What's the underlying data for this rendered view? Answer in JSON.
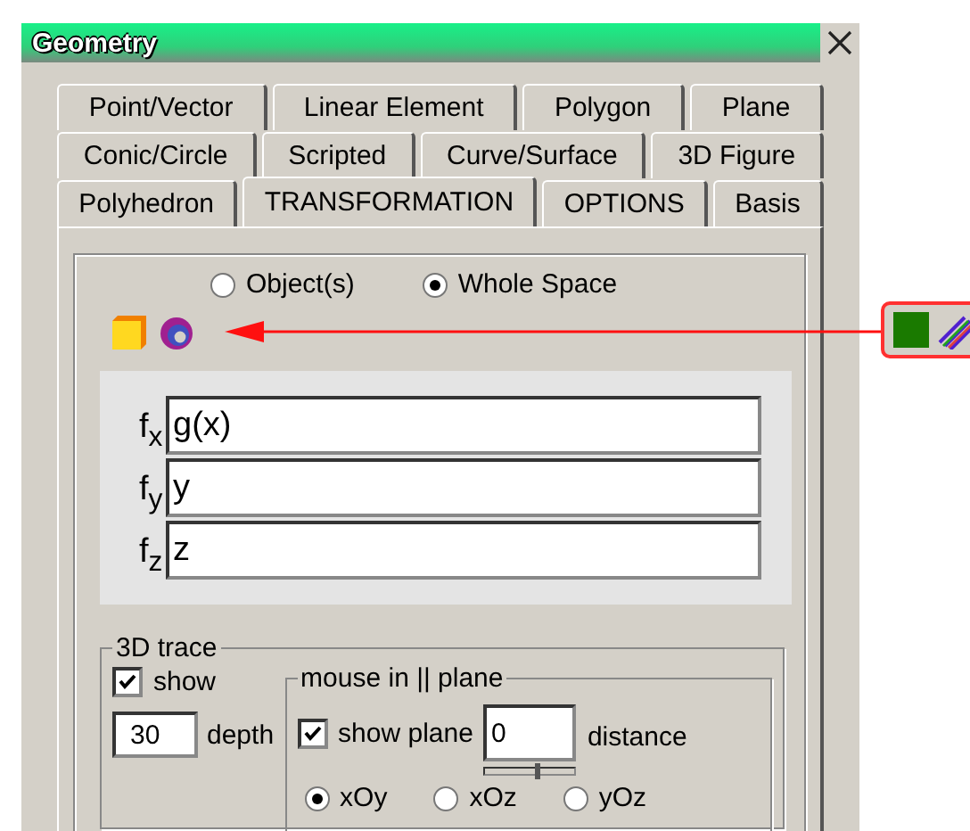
{
  "window": {
    "title": "Geometry"
  },
  "tab_rows": [
    [
      {
        "label": "Point/Vector",
        "selected": false
      },
      {
        "label": "Linear Element",
        "selected": false
      },
      {
        "label": "Polygon",
        "selected": false
      },
      {
        "label": "Plane",
        "selected": false
      }
    ],
    [
      {
        "label": "Conic/Circle",
        "selected": false
      },
      {
        "label": "Scripted",
        "selected": false
      },
      {
        "label": "Curve/Surface",
        "selected": false
      },
      {
        "label": "3D Figure",
        "selected": false
      }
    ],
    [
      {
        "label": "Polyhedron",
        "selected": false
      },
      {
        "label": "TRANSFORMATION",
        "selected": true
      },
      {
        "label": "OPTIONS",
        "selected": false
      },
      {
        "label": "Basis",
        "selected": false
      }
    ]
  ],
  "scope": [
    {
      "label": "Object(s)",
      "selected": false
    },
    {
      "label": "Whole Space",
      "selected": true
    }
  ],
  "functions": [
    {
      "label": "f$_{x}$",
      "value": "g(x)"
    },
    {
      "label": "f$_{y}$",
      "value": "y"
    },
    {
      "label": "f$_{z}$",
      "value": "z"
    }
  ],
  "trace": {
    "title": "3D trace",
    "show": {
      "label": "show",
      "checked": true
    },
    "depth": {
      "value": "30",
      "label": "depth"
    },
    "plane_group": {
      "title": "mouse in || plane",
      "show_plane": {
        "label": "show plane",
        "checked": true
      },
      "distance": {
        "value": "0",
        "label": "distance",
        "level": 0.55
      },
      "planes": [
        {
          "label": "xOy",
          "selected": true
        },
        {
          "label": "xOz",
          "selected": false
        },
        {
          "label": "yOz",
          "selected": false
        }
      ]
    }
  }
}
